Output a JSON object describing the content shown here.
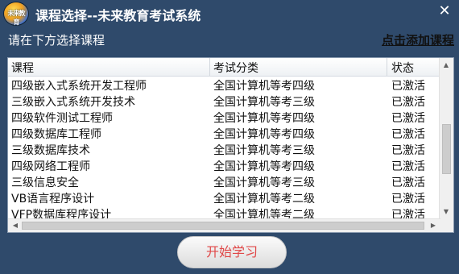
{
  "window": {
    "title": "课程选择--未来教育考试系统",
    "logo_text": "未来教育",
    "close_glyph": "✕"
  },
  "instruction": "请在下方选择课程",
  "add_link_label": "点击添加课程",
  "table": {
    "headers": [
      "课程",
      "考试分类",
      "状态"
    ],
    "rows": [
      [
        "四级嵌入式系统开发工程师",
        "全国计算机等考四级",
        "已激活"
      ],
      [
        "三级嵌入式系统开发技术",
        "全国计算机等考三级",
        "已激活"
      ],
      [
        "四级软件测试工程师",
        "全国计算机等考四级",
        "已激活"
      ],
      [
        "四级数据库工程师",
        "全国计算机等考四级",
        "已激活"
      ],
      [
        "三级数据库技术",
        "全国计算机等考三级",
        "已激活"
      ],
      [
        "四级网络工程师",
        "全国计算机等考四级",
        "已激活"
      ],
      [
        "三级信息安全",
        "全国计算机等考三级",
        "已激活"
      ],
      [
        "VB语言程序设计",
        "全国计算机等考二级",
        "已激活"
      ],
      [
        "VFP数据库程序设计",
        "全国计算机等考二级",
        "已激活"
      ]
    ]
  },
  "start_button_label": "开始学习",
  "colors": {
    "window_bg": "#2f4a6b",
    "start_text": "#e04848"
  }
}
